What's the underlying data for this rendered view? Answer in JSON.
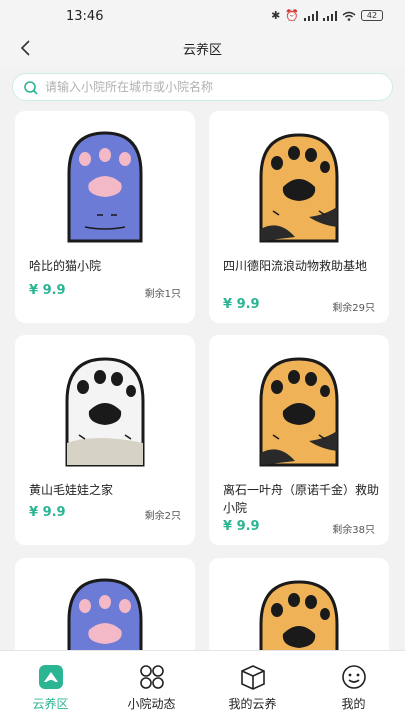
{
  "status": {
    "time": "13:46",
    "battery": "42"
  },
  "header": {
    "title": "云养区"
  },
  "search": {
    "placeholder": "请输入小院所在城市或小院名称"
  },
  "cards": [
    {
      "name": "哈比的猫小院",
      "price": "¥ 9.9",
      "remain": "剩余1只",
      "paw": "purple"
    },
    {
      "name": "四川德阳流浪动物救助基地",
      "price": "¥ 9.9",
      "remain": "剩余29只",
      "paw": "orange"
    },
    {
      "name": "黄山毛娃娃之家",
      "price": "¥ 9.9",
      "remain": "剩余2只",
      "paw": "white"
    },
    {
      "name": "离石一叶舟（原诺千金）救助小院",
      "price": "¥ 9.9",
      "remain": "剩余38只",
      "paw": "orange"
    },
    {
      "name": "",
      "price": "",
      "remain": "",
      "paw": "purple"
    },
    {
      "name": "",
      "price": "",
      "remain": "",
      "paw": "orange"
    }
  ],
  "tabs": [
    {
      "label": "云养区",
      "icon": "yunyang-icon",
      "active": true
    },
    {
      "label": "小院动态",
      "icon": "grid-circles-icon",
      "active": false
    },
    {
      "label": "我的云养",
      "icon": "box-icon",
      "active": false
    },
    {
      "label": "我的",
      "icon": "smiley-icon",
      "active": false
    }
  ],
  "colors": {
    "accent": "#2bb592",
    "paw_purple": "#6b7bd6",
    "paw_orange": "#f0b257",
    "paw_white": "#f4f4f4"
  }
}
